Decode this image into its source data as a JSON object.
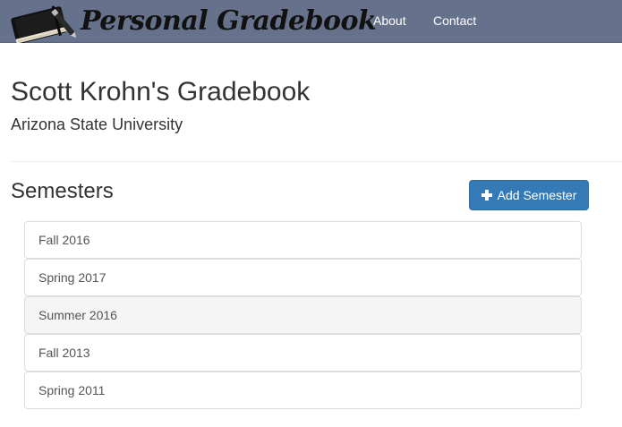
{
  "navbar": {
    "brand": "Personal Gradebook",
    "links": [
      {
        "label": "About"
      },
      {
        "label": "Contact"
      }
    ],
    "background": "#66728b"
  },
  "header": {
    "title": "Scott Krohn's Gradebook",
    "subtitle": "Arizona State University"
  },
  "semesters": {
    "section_title": "Semesters",
    "add_button_label": "Add Semester",
    "add_button_icon": "plus-icon",
    "button_color": "#337ab7",
    "items": [
      {
        "label": "Fall 2016"
      },
      {
        "label": "Spring 2017"
      },
      {
        "label": "Summer 2016"
      },
      {
        "label": "Fall 2013"
      },
      {
        "label": "Spring 2011"
      }
    ]
  }
}
